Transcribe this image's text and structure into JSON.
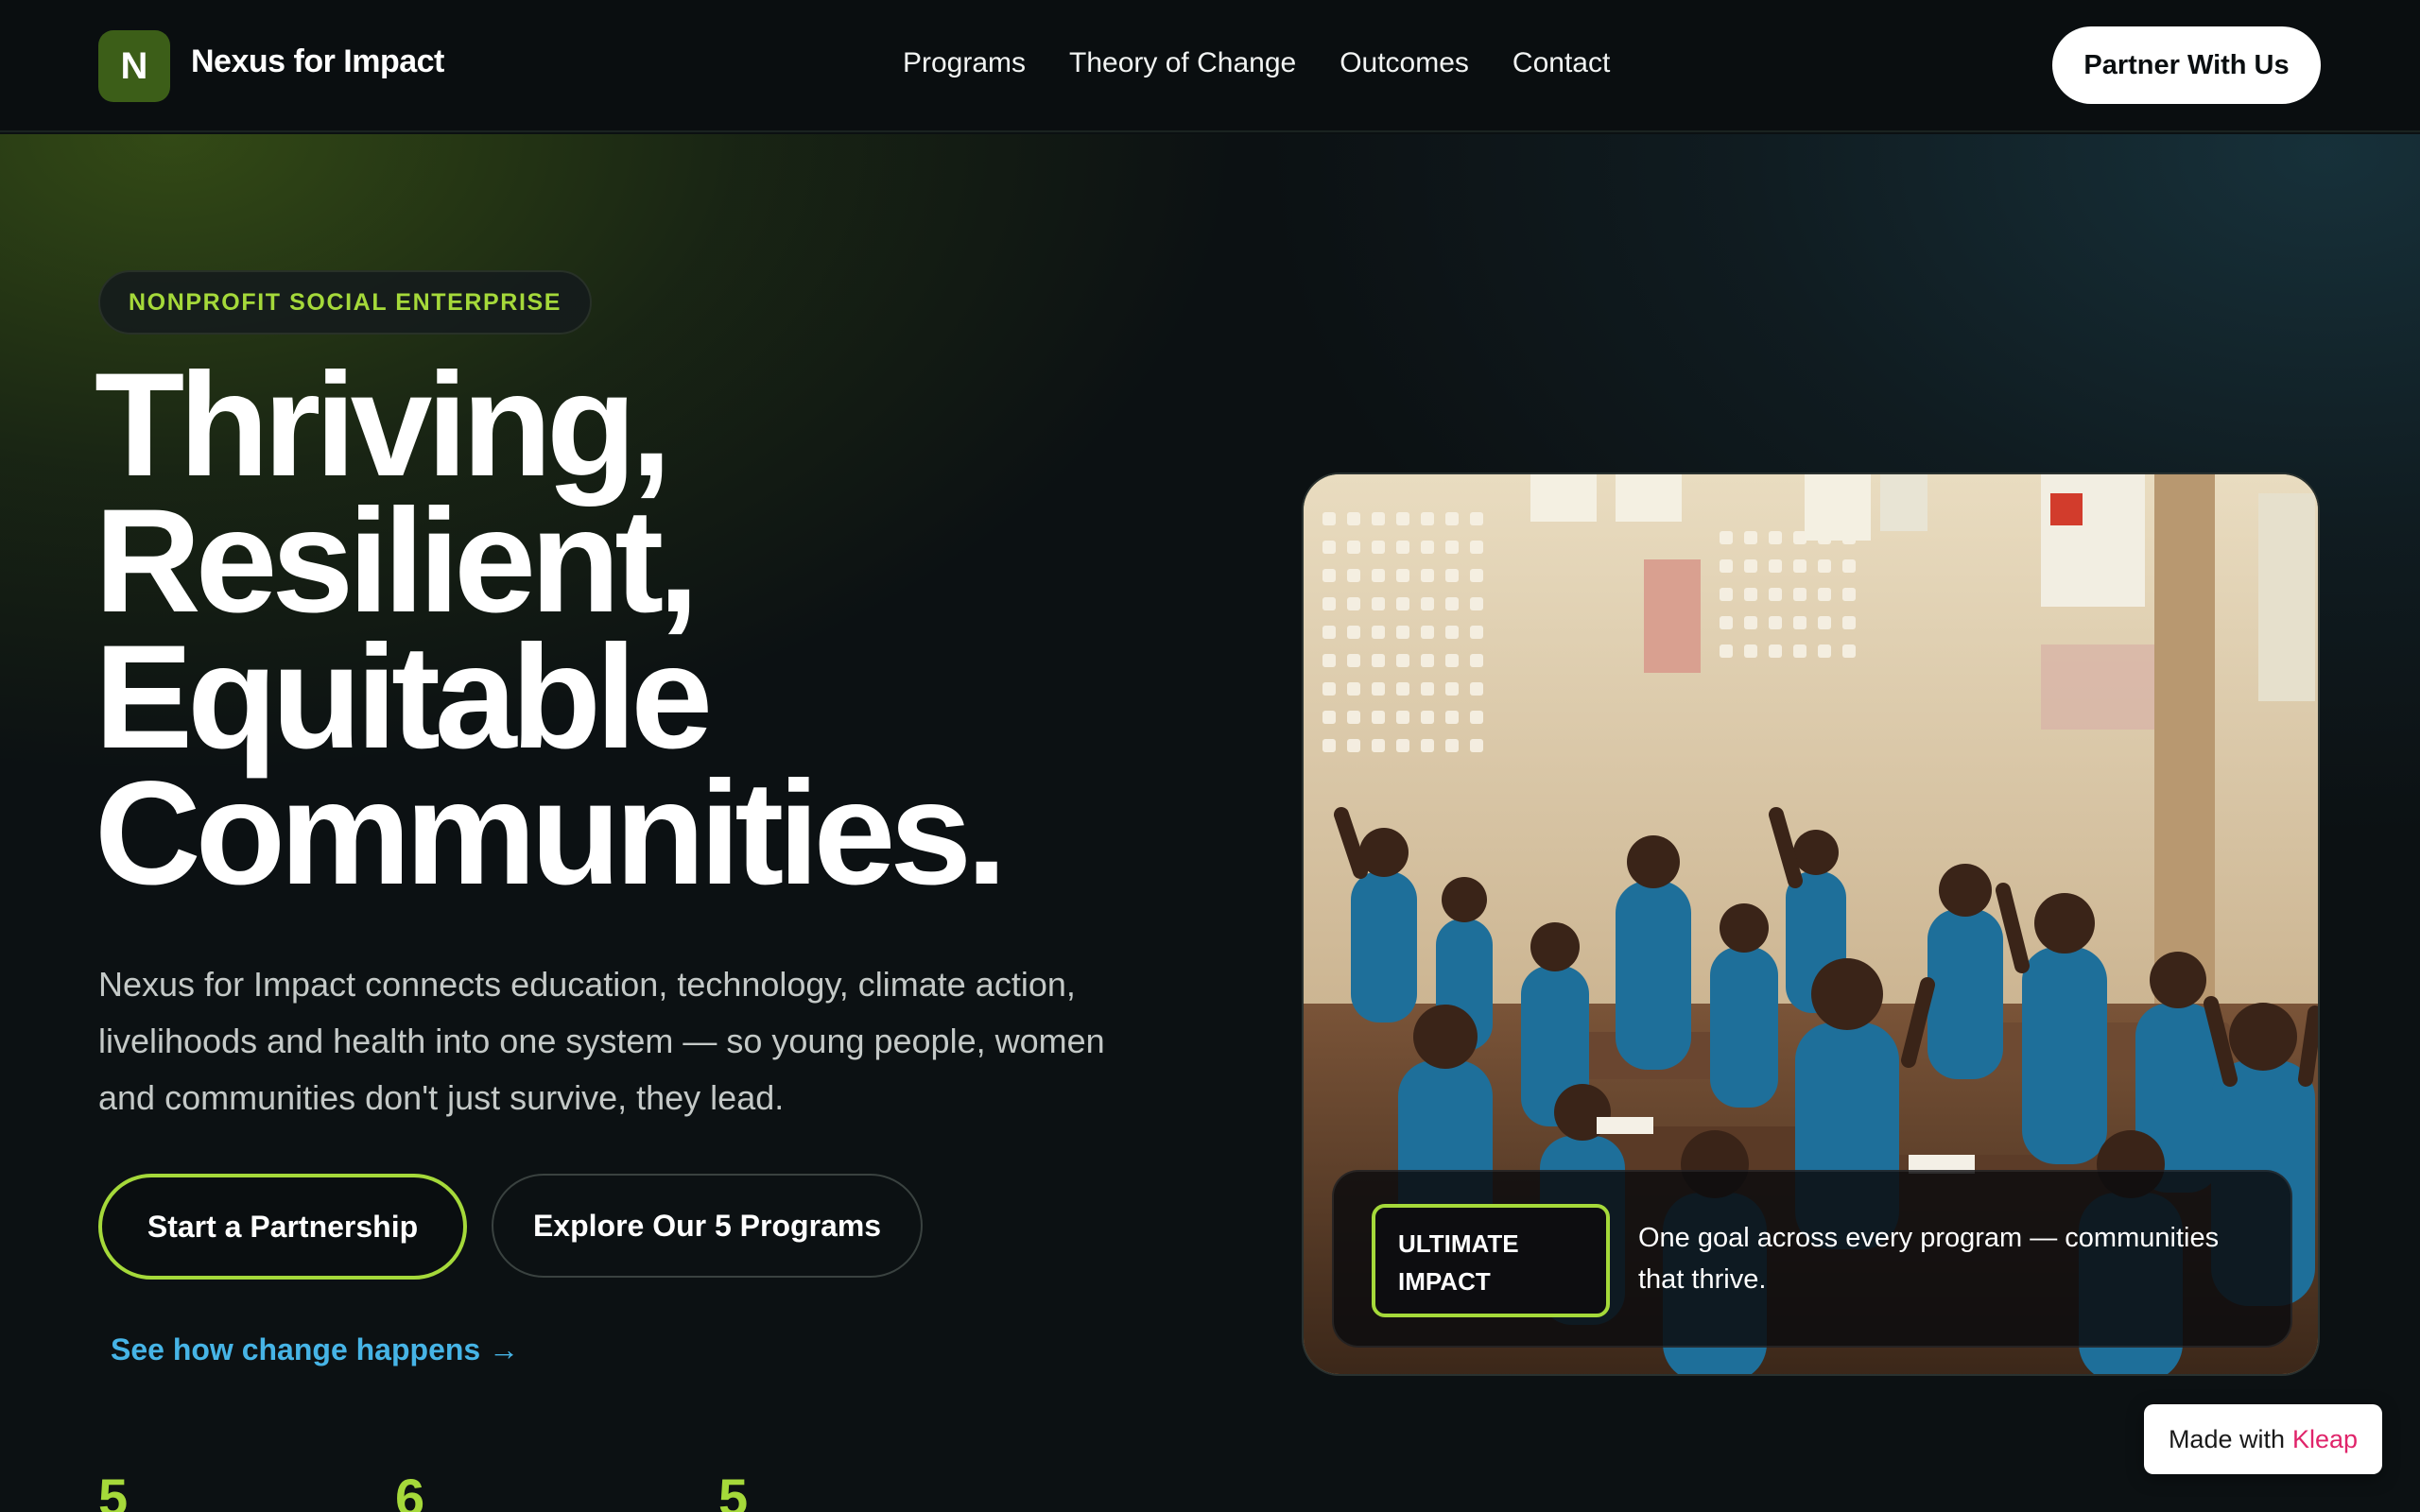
{
  "nav": {
    "logo_letter": "N",
    "brand": "Nexus for Impact",
    "links": [
      "Programs",
      "Theory of Change",
      "Outcomes",
      "Contact"
    ],
    "cta": "Partner With Us"
  },
  "hero": {
    "badge": "NONPROFIT SOCIAL ENTERPRISE",
    "headline": [
      "Thriving,",
      "Resilient,",
      "Equitable",
      "Communities."
    ],
    "subcopy": "Nexus for Impact connects education, technology, climate action, livelihoods and health into one system — so young people, women and communities don't just survive, they lead.",
    "primary_button": "Start a Partnership",
    "secondary_button": "Explore Our 5 Programs",
    "link": "See how change happens →",
    "stats": [
      "5",
      "6",
      "5"
    ]
  },
  "photo": {
    "tag": "ULTIMATE IMPACT",
    "caption": "One goal across every program — communities that thrive."
  },
  "footer_badge": {
    "prefix": "Made with",
    "brand": "Kleap"
  },
  "colors": {
    "accent_green": "#a5d93a",
    "link_blue": "#46b4e6",
    "logo_green": "#3c5e18",
    "kleap_pink": "#e0246a",
    "background": "#0b1012"
  }
}
